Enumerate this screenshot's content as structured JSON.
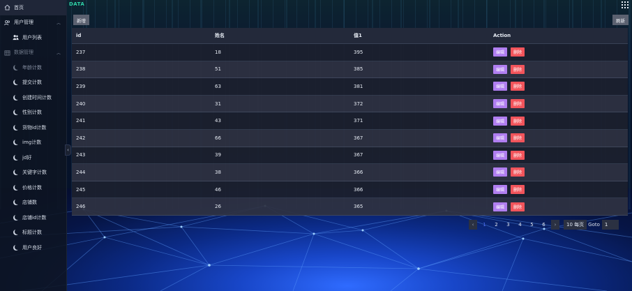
{
  "header": {
    "logo_text": "DATA"
  },
  "sidebar": {
    "home": "首页",
    "user_mgmt": "用户管理",
    "user_list": "用户列表",
    "data_mgmt": "数据管理",
    "items": [
      "年龄计数",
      "提交计数",
      "创建时间计数",
      "性别计数",
      "货物id计数",
      "img计数",
      "jd好",
      "关键字计数",
      "价格计数",
      "店铺数",
      "店铺id计数",
      "标题计数",
      "用户良好"
    ]
  },
  "toolbar": {
    "add_label": "新增",
    "refresh_label": "刷新"
  },
  "table": {
    "columns": [
      "id",
      "姓名",
      "值1",
      "Action"
    ],
    "rows": [
      [
        "237",
        "18",
        "395"
      ],
      [
        "238",
        "51",
        "385"
      ],
      [
        "239",
        "63",
        "381"
      ],
      [
        "240",
        "31",
        "372"
      ],
      [
        "241",
        "43",
        "371"
      ],
      [
        "242",
        "66",
        "367"
      ],
      [
        "243",
        "39",
        "367"
      ],
      [
        "244",
        "38",
        "366"
      ],
      [
        "245",
        "46",
        "366"
      ],
      [
        "246",
        "26",
        "365"
      ]
    ],
    "edit_label": "编辑",
    "delete_label": "删除"
  },
  "pagination": {
    "pages": [
      "1",
      "2",
      "3",
      "4",
      "5",
      "6"
    ],
    "current": "1",
    "page_size": "10 每页",
    "goto_label": "Goto",
    "goto_value": "1"
  },
  "colors": {
    "edit": "#b07ef0",
    "delete": "#f2545b",
    "accent": "#4b6cf0"
  }
}
